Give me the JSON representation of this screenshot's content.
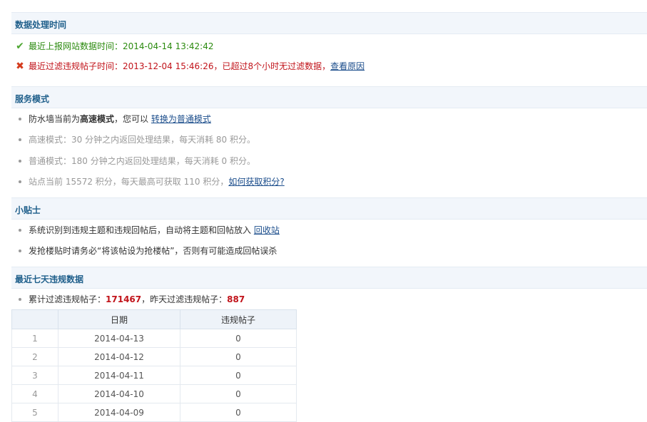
{
  "sections": {
    "processing_time": {
      "title": "数据处理时间",
      "report_label": "最近上报网站数据时间：",
      "report_value": "2014-04-14 13:42:42",
      "filter_label": "最近过滤违规帖子时间：",
      "filter_value": "2013-12-04 15:46:26",
      "filter_warning": "，已超过8个小时无过滤数据，",
      "filter_link": "查看原因"
    },
    "service_mode": {
      "title": "服务模式",
      "current_prefix": "防水墙当前为",
      "current_mode": "高速模式",
      "current_mid": "，您可以",
      "switch_link": "转换为普通模式",
      "fast_desc": "高速模式：30 分钟之内返回处理结果，每天消耗 80 积分。",
      "normal_desc": "普通模式：180 分钟之内返回处理结果，每天消耗 0 积分。",
      "points_desc": "站点当前 15572 积分，每天最高可获取 110 积分，",
      "points_link": "如何获取积分?"
    },
    "tips": {
      "title": "小贴士",
      "tip1_text": "系统识别到违规主题和违规回帖后，自动将主题和回帖放入",
      "tip1_link": "回收站",
      "tip2_text": "发抢楼贴时请务必“将该帖设为抢楼帖”，否则有可能造成回帖误杀"
    },
    "recent": {
      "title": "最近七天违规数据",
      "total_label": "累计过滤违规帖子：",
      "total_value": "171467",
      "yesterday_label": "，昨天过滤违规帖子：",
      "yesterday_value": "887",
      "table": {
        "headers": [
          "",
          "日期",
          "违规帖子"
        ],
        "rows": [
          [
            "1",
            "2014-04-13",
            "0"
          ],
          [
            "2",
            "2014-04-12",
            "0"
          ],
          [
            "3",
            "2014-04-11",
            "0"
          ],
          [
            "4",
            "2014-04-10",
            "0"
          ],
          [
            "5",
            "2014-04-09",
            "0"
          ]
        ]
      }
    }
  },
  "colors": {
    "section_bg": "#f2f6fb",
    "section_title": "#1f5f8b",
    "success": "#2b8a0f",
    "error": "#c1131a",
    "link": "#1c4e8c"
  },
  "icons": {
    "success": "check-icon",
    "error": "close-icon"
  }
}
